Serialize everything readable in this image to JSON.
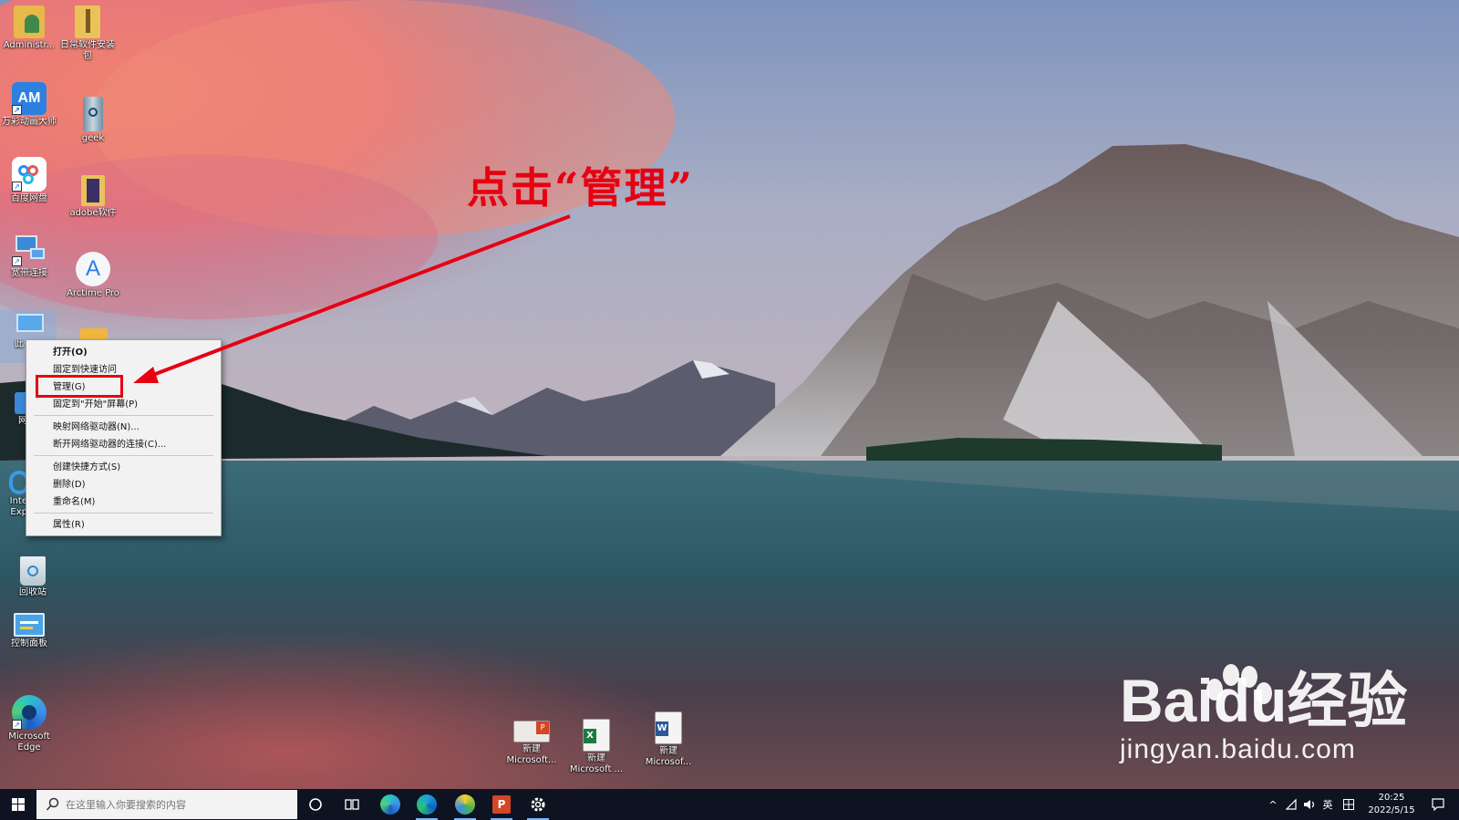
{
  "annotation": {
    "text": "点击“管理”"
  },
  "desktop": {
    "icons": [
      {
        "label": "Administr..."
      },
      {
        "label": "日常软件安装"
      },
      {
        "label": "包"
      },
      {
        "label": "万彩动画大师"
      },
      {
        "label": "geek"
      },
      {
        "label": "百度网盘"
      },
      {
        "label": "adobe软件"
      },
      {
        "label": "宽带连接"
      },
      {
        "label": "Arctime Pro"
      },
      {
        "label": "此"
      },
      {
        "label": "网"
      },
      {
        "label": "Inte"
      },
      {
        "label": "Exp"
      },
      {
        "label": "回收站"
      },
      {
        "label": "控制面板"
      },
      {
        "label": "Microsoft"
      },
      {
        "label": "Edge"
      },
      {
        "label": "新建"
      },
      {
        "label": "Microsoft..."
      },
      {
        "label": "新建"
      },
      {
        "label": "Microsoft ..."
      },
      {
        "label": "新建"
      },
      {
        "label": "Microsof..."
      }
    ]
  },
  "context_menu": {
    "items": [
      "打开(O)",
      "固定到快速访问",
      "管理(G)",
      "固定到\"开始\"屏幕(P)",
      "映射网络驱动器(N)...",
      "断开网络驱动器的连接(C)...",
      "创建快捷方式(S)",
      "删除(D)",
      "重命名(M)",
      "属性(R)"
    ]
  },
  "watermark": {
    "brand_bai": "Bai",
    "brand_du": "du",
    "brand_suffix": "经验",
    "url": "jingyan.baidu.com"
  },
  "taskbar": {
    "search_placeholder": "在这里输入你要搜索的内容",
    "tray": {
      "chevron": "^",
      "ime": "英",
      "time": "20:25",
      "date": "2022/5/15"
    }
  },
  "colors": {
    "annotation_red": "#e60012",
    "taskbar_bg": "#0d1320",
    "menu_bg": "#f2f2f2"
  }
}
